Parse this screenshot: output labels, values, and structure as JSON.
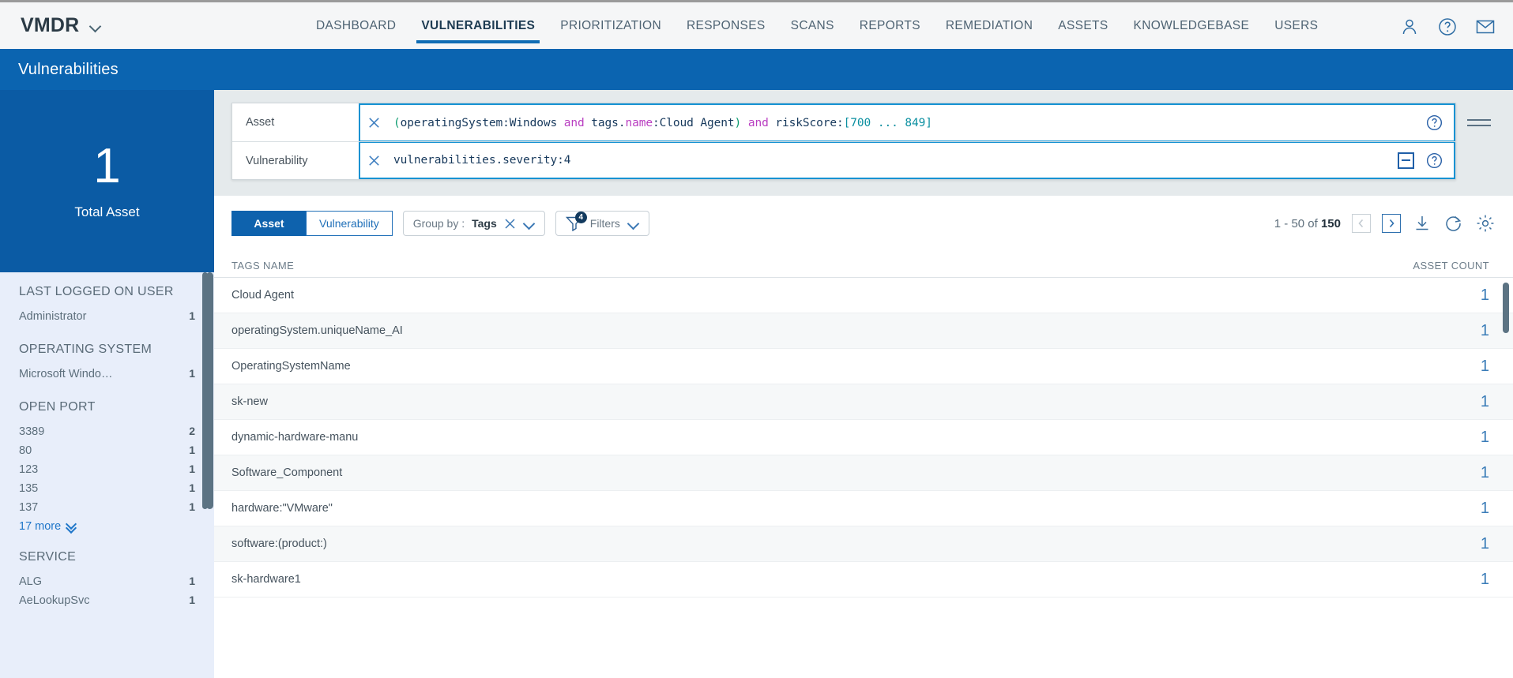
{
  "app": {
    "brand": "VMDR",
    "brand_caret": "chevron-down"
  },
  "topnav": {
    "items": [
      {
        "label": "DASHBOARD",
        "active": false
      },
      {
        "label": "VULNERABILITIES",
        "active": true
      },
      {
        "label": "PRIORITIZATION",
        "active": false
      },
      {
        "label": "RESPONSES",
        "active": false
      },
      {
        "label": "SCANS",
        "active": false
      },
      {
        "label": "REPORTS",
        "active": false
      },
      {
        "label": "REMEDIATION",
        "active": false
      },
      {
        "label": "ASSETS",
        "active": false
      },
      {
        "label": "KNOWLEDGEBASE",
        "active": false
      },
      {
        "label": "USERS",
        "active": false
      }
    ],
    "icons": [
      "user-icon",
      "help-icon",
      "mail-icon"
    ]
  },
  "page": {
    "title": "Vulnerabilities",
    "title_bar_color": "#0b64b0"
  },
  "kpi": {
    "value": "1",
    "label": "Total Asset"
  },
  "facets": [
    {
      "title": "LAST LOGGED ON USER",
      "rows": [
        {
          "label": "Administrator",
          "count": "1"
        }
      ],
      "more": null
    },
    {
      "title": "OPERATING SYSTEM",
      "rows": [
        {
          "label": "Microsoft Windo…",
          "count": "1"
        }
      ],
      "more": null
    },
    {
      "title": "OPEN PORT",
      "rows": [
        {
          "label": "3389",
          "count": "2"
        },
        {
          "label": "80",
          "count": "1"
        },
        {
          "label": "123",
          "count": "1"
        },
        {
          "label": "135",
          "count": "1"
        },
        {
          "label": "137",
          "count": "1"
        }
      ],
      "more": "17 more"
    },
    {
      "title": "SERVICE",
      "rows": [
        {
          "label": "ALG",
          "count": "1"
        },
        {
          "label": "AeLookupSvc",
          "count": "1"
        }
      ],
      "more": null
    }
  ],
  "query": {
    "rows": [
      {
        "label": "Asset",
        "tokens": [
          {
            "t": "(",
            "c": "paren"
          },
          {
            "t": "operatingSystem:Windows ",
            "c": "field"
          },
          {
            "t": "and ",
            "c": "op"
          },
          {
            "t": "tags.",
            "c": "field"
          },
          {
            "t": "name",
            "c": "op"
          },
          {
            "t": ":Cloud Agent",
            "c": "field"
          },
          {
            "t": ")",
            "c": "paren"
          },
          {
            "t": " ",
            "c": "field"
          },
          {
            "t": "and ",
            "c": "op"
          },
          {
            "t": "riskScore:",
            "c": "field"
          },
          {
            "t": "[700 ... 849]",
            "c": "num"
          }
        ],
        "plain": "(operatingSystem:Windows and tags.name:Cloud Agent) and riskScore:[700 ... 849]",
        "has_minimize": false,
        "help": "help-icon",
        "clear": "clear-icon"
      },
      {
        "label": "Vulnerability",
        "tokens": [
          {
            "t": "vulnerabilities.severity:4",
            "c": "field"
          }
        ],
        "plain": "vulnerabilities.severity:4",
        "has_minimize": true,
        "help": "help-icon",
        "clear": "clear-icon"
      }
    ],
    "menu_icon": "hamburger-icon"
  },
  "toolbar": {
    "segments": [
      {
        "label": "Asset",
        "active": true
      },
      {
        "label": "Vulnerability",
        "active": false
      }
    ],
    "group_by_label": "Group by :",
    "group_by_value": "Tags",
    "filters_label": "Filters",
    "filters_count": "4",
    "pagination": {
      "range": "1 - 50 of ",
      "total": "150",
      "prev": "prev-page",
      "next": "next-page"
    },
    "actions": [
      "download-icon",
      "refresh-icon",
      "settings-icon"
    ]
  },
  "table": {
    "columns": {
      "name": "TAGS NAME",
      "count": "ASSET COUNT"
    },
    "rows": [
      {
        "name": "Cloud Agent",
        "count": "1"
      },
      {
        "name": "operatingSystem.uniqueName_AI",
        "count": "1"
      },
      {
        "name": "OperatingSystemName",
        "count": "1"
      },
      {
        "name": "sk-new",
        "count": "1"
      },
      {
        "name": "dynamic-hardware-manu",
        "count": "1"
      },
      {
        "name": "Software_Component",
        "count": "1"
      },
      {
        "name": "hardware:\"VMware\"",
        "count": "1"
      },
      {
        "name": "software:(product:)",
        "count": "1"
      },
      {
        "name": "sk-hardware1",
        "count": "1"
      }
    ]
  },
  "colors": {
    "accent_blue": "#0b64b0",
    "kpi_blue": "#0b5ba4",
    "facet_bg": "#e8eefa",
    "query_bg": "#e5eaec",
    "link_blue": "#3a7cb8"
  }
}
